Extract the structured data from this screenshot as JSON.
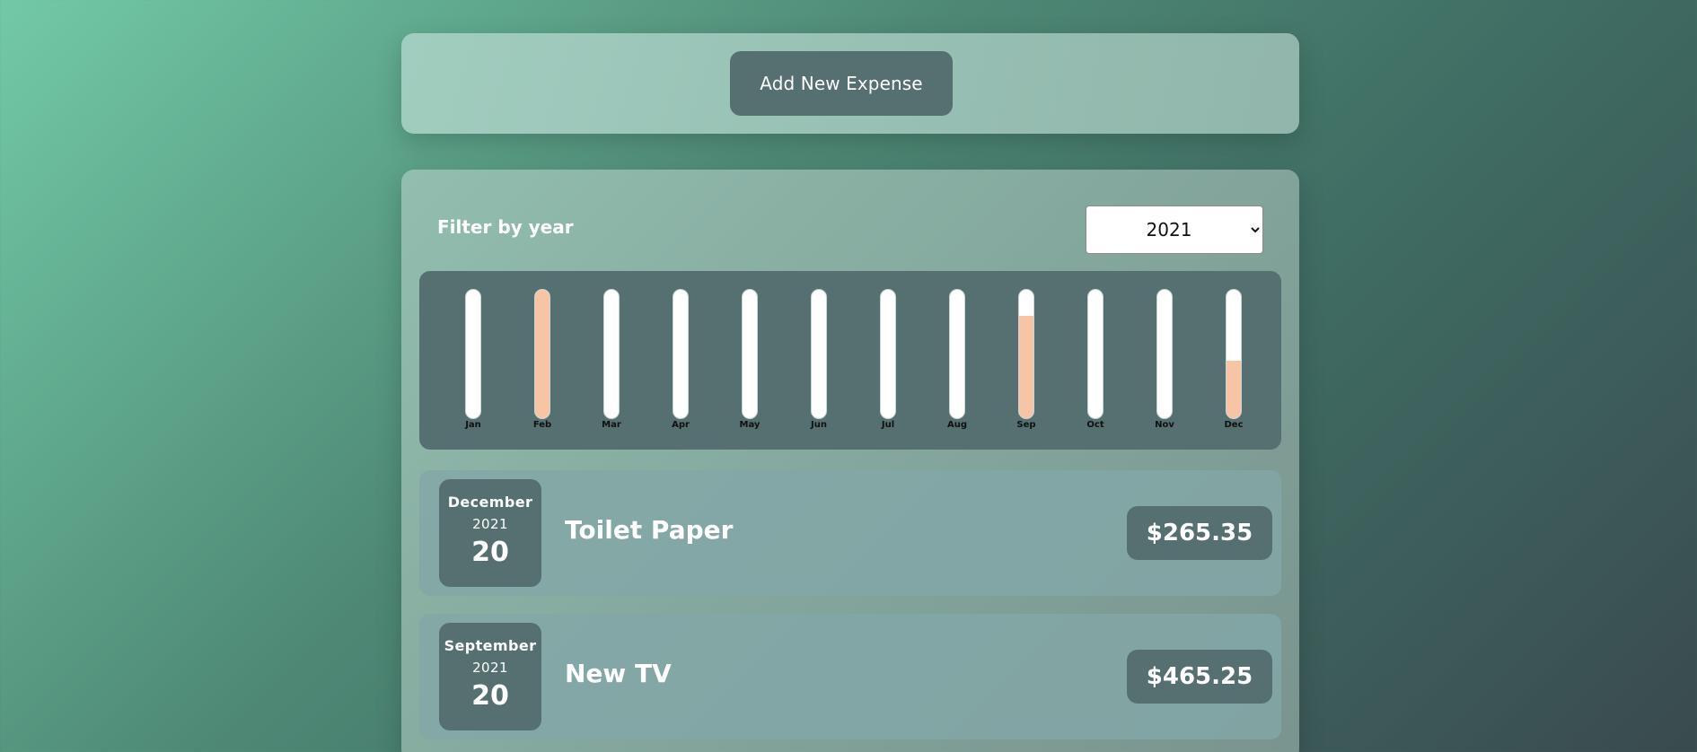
{
  "header": {
    "add_button_label": "Add New Expense"
  },
  "filter": {
    "label": "Filter by year",
    "selected_year": "2021",
    "options": [
      "2021"
    ]
  },
  "chart_data": {
    "type": "bar",
    "categories": [
      "Jan",
      "Feb",
      "Mar",
      "Apr",
      "May",
      "Jun",
      "Jul",
      "Aug",
      "Sep",
      "Oct",
      "Nov",
      "Dec"
    ],
    "values": [
      0,
      100,
      0,
      0,
      0,
      0,
      0,
      0,
      80,
      0,
      0,
      45
    ],
    "ylim": [
      0,
      100
    ],
    "grid": false
  },
  "expenses": [
    {
      "month": "December",
      "year": "2021",
      "day": "20",
      "title": "Toilet Paper",
      "amount": "$265.35"
    },
    {
      "month": "September",
      "year": "2021",
      "day": "20",
      "title": "New TV",
      "amount": "$465.25"
    }
  ],
  "colors": {
    "dark_panel": "#566f70",
    "bar_fill": "#f7c4a6",
    "text_light": "#ffffff"
  }
}
